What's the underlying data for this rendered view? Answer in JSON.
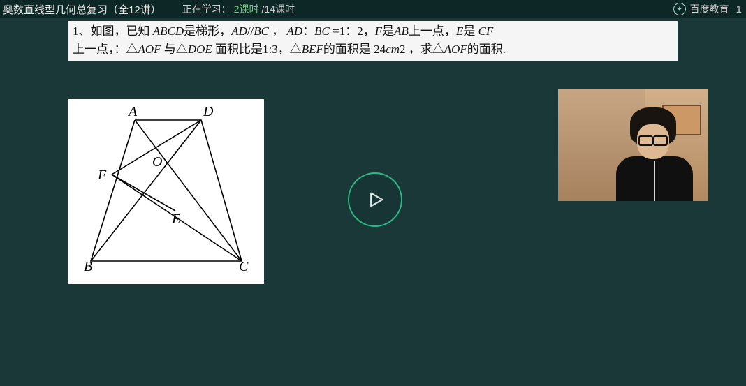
{
  "header": {
    "course_title": "奥数直线型几何总复习（全12讲）",
    "study_label": "正在学习：",
    "lesson_current": "2课时",
    "lesson_total": "/14课时",
    "brand_text": "百度教育",
    "brand_num": "1"
  },
  "problem": {
    "line1_a": "1、如图，已知 ",
    "line1_b": "ABCD",
    "line1_c": "是梯形，",
    "line1_d": "AD",
    "line1_e": "//",
    "line1_f": "BC",
    "line1_g": " ，  ",
    "line1_h": "AD",
    "line1_i": "：",
    "line1_j": "BC",
    "line1_k": " =1：2，",
    "line1_l": "F",
    "line1_m": "是",
    "line1_n": "AB",
    "line1_o": "上一点，",
    "line1_p": "E",
    "line1_q": "是 ",
    "line1_r": "CF",
    "line2_a": "上一点，：△",
    "line2_b": "AOF",
    "line2_c": " 与△",
    "line2_d": "DOE",
    "line2_e": " 面积比是1:3，△",
    "line2_f": "BEF",
    "line2_g": "的面积是 24",
    "line2_h": "cm",
    "line2_i": "2 ，求△",
    "line2_j": "AOF",
    "line2_k": "的面积."
  },
  "diagram": {
    "points": {
      "A": "A",
      "B": "B",
      "C": "C",
      "D": "D",
      "E": "E",
      "F": "F",
      "O": "O"
    }
  },
  "controls": {
    "play_label": "play"
  },
  "webcam": {
    "alt": "instructor-webcam"
  }
}
